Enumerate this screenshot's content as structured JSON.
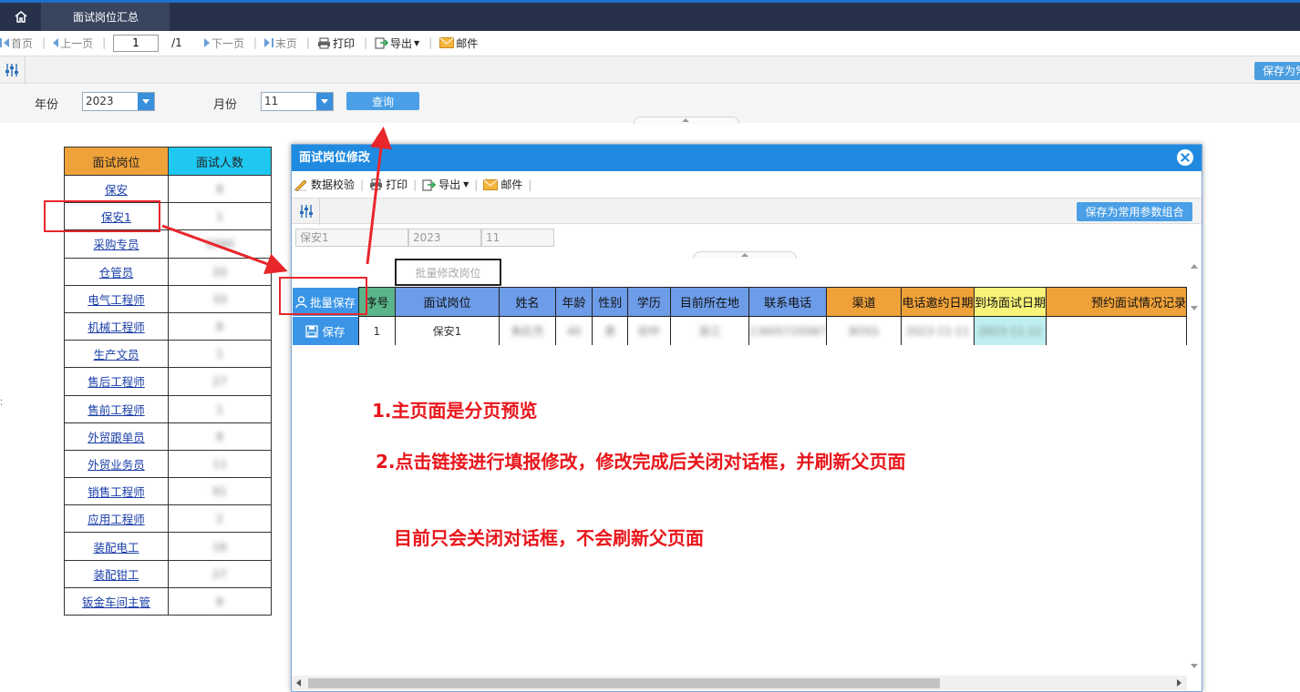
{
  "top_tabs": {
    "active": "面试岗位汇总"
  },
  "pager": {
    "first": "首页",
    "prev": "上一页",
    "current_page": "1",
    "total": "/1",
    "next": "下一页",
    "last": "末页",
    "print": "打印",
    "export": "导出",
    "mail": "邮件"
  },
  "params": {
    "save_combo_label": "保存为常"
  },
  "query": {
    "year_label": "年份",
    "year_value": "2023",
    "month_label": "月份",
    "month_value": "11",
    "query_button": "查询"
  },
  "summary_table": {
    "col_position": "面试岗位",
    "col_count": "面试人数",
    "rows": [
      {
        "position": "保安",
        "count": "8"
      },
      {
        "position": "保安1",
        "count": "1"
      },
      {
        "position": "采购专员",
        "count": "5090"
      },
      {
        "position": "仓管员",
        "count": "20"
      },
      {
        "position": "电气工程师",
        "count": "33"
      },
      {
        "position": "机械工程师",
        "count": "8"
      },
      {
        "position": "生产文员",
        "count": "1"
      },
      {
        "position": "售后工程师",
        "count": "27"
      },
      {
        "position": "售前工程师",
        "count": "1"
      },
      {
        "position": "外贸跟单员",
        "count": "8"
      },
      {
        "position": "外贸业务员",
        "count": "11"
      },
      {
        "position": "销售工程师",
        "count": "91"
      },
      {
        "position": "应用工程师",
        "count": "2"
      },
      {
        "position": "装配电工",
        "count": "16"
      },
      {
        "position": "装配钳工",
        "count": "27"
      },
      {
        "position": "钣金车间主管",
        "count": "8"
      }
    ]
  },
  "dialog": {
    "title": "面试岗位修改",
    "toolbar": {
      "validate": "数据校验",
      "print": "打印",
      "export": "导出",
      "mail": "邮件"
    },
    "save_combo": "保存为常用参数组合",
    "param_values": [
      "保安1",
      "2023",
      "11"
    ],
    "batch_post_button": "批量修改岗位",
    "batch_save": "批量保存",
    "row_save": "保存",
    "headers": [
      "序号",
      "面试岗位",
      "姓名",
      "年龄",
      "性别",
      "学历",
      "目前所在地",
      "联系电话",
      "渠道",
      "电话邀约日期",
      "到场面试日期",
      "预约面试情况记录"
    ],
    "row": [
      "1",
      "保安1",
      "朱红杰",
      "40",
      "男",
      "初中",
      "浙江",
      "13605720087",
      "BOSS",
      "2023-11-11",
      "2023-11-12",
      ""
    ]
  },
  "annotations": {
    "line1": "1.主页面是分页预览",
    "line2": "2.点击链接进行填报修改，修改完成后关闭对话框，并刷新父页面",
    "line3": "目前只会关闭对话框，不会刷新父页面"
  },
  "colors": {
    "accent_blue": "#1f8ae0",
    "header_orange": "#f0a23a",
    "header_cyan": "#1ec8f0",
    "annotation_red": "#e8161b"
  }
}
